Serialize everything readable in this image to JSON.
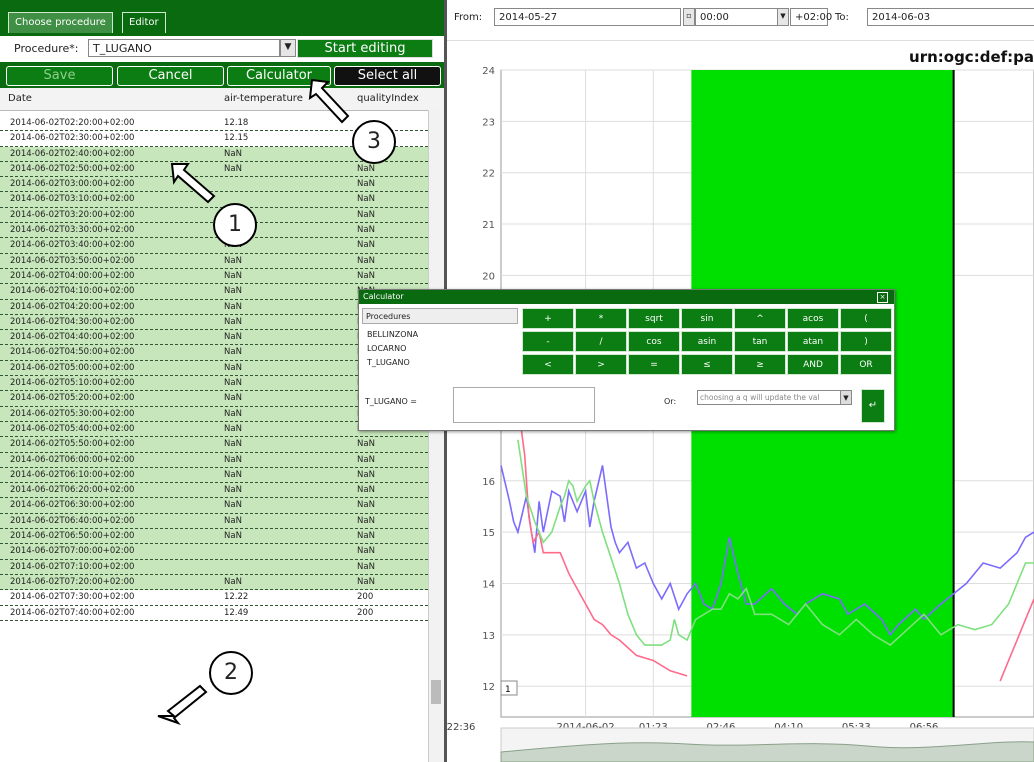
{
  "tabs": [
    {
      "label": "Choose procedure"
    },
    {
      "label": "Editor"
    }
  ],
  "procedure": {
    "label": "Procedure*:",
    "value": "T_LUGANO",
    "start_label": "Start editing"
  },
  "toolbar": {
    "save": "Save",
    "cancel": "Cancel",
    "calculator": "Calculator",
    "select_all": "Select all"
  },
  "table": {
    "headers": [
      "Date",
      "air-temperature",
      "qualityIndex"
    ],
    "rows": [
      {
        "date": "2014-06-02T02:20:00+02:00",
        "temp": "12.18",
        "q": ""
      },
      {
        "date": "2014-06-02T02:30:00+02:00",
        "temp": "12.15",
        "q": ""
      },
      {
        "date": "2014-06-02T02:40:00+02:00",
        "temp": "NaN",
        "q": "NaN"
      },
      {
        "date": "2014-06-02T02:50:00+02:00",
        "temp": "NaN",
        "q": "NaN"
      },
      {
        "date": "2014-06-02T03:00:00+02:00",
        "temp": "",
        "q": "NaN"
      },
      {
        "date": "2014-06-02T03:10:00+02:00",
        "temp": "",
        "q": "NaN"
      },
      {
        "date": "2014-06-02T03:20:00+02:00",
        "temp": "",
        "q": "NaN"
      },
      {
        "date": "2014-06-02T03:30:00+02:00",
        "temp": "NaN",
        "q": "NaN"
      },
      {
        "date": "2014-06-02T03:40:00+02:00",
        "temp": "NaN",
        "q": "NaN"
      },
      {
        "date": "2014-06-02T03:50:00+02:00",
        "temp": "NaN",
        "q": "NaN"
      },
      {
        "date": "2014-06-02T04:00:00+02:00",
        "temp": "NaN",
        "q": "NaN"
      },
      {
        "date": "2014-06-02T04:10:00+02:00",
        "temp": "NaN",
        "q": "NaN"
      },
      {
        "date": "2014-06-02T04:20:00+02:00",
        "temp": "NaN",
        "q": "NaN"
      },
      {
        "date": "2014-06-02T04:30:00+02:00",
        "temp": "NaN",
        "q": "NaN"
      },
      {
        "date": "2014-06-02T04:40:00+02:00",
        "temp": "NaN",
        "q": "NaN"
      },
      {
        "date": "2014-06-02T04:50:00+02:00",
        "temp": "NaN",
        "q": "NaN"
      },
      {
        "date": "2014-06-02T05:00:00+02:00",
        "temp": "NaN",
        "q": "NaN"
      },
      {
        "date": "2014-06-02T05:10:00+02:00",
        "temp": "NaN",
        "q": "NaN"
      },
      {
        "date": "2014-06-02T05:20:00+02:00",
        "temp": "NaN",
        "q": "NaN"
      },
      {
        "date": "2014-06-02T05:30:00+02:00",
        "temp": "NaN",
        "q": "NaN"
      },
      {
        "date": "2014-06-02T05:40:00+02:00",
        "temp": "NaN",
        "q": "NaN"
      },
      {
        "date": "2014-06-02T05:50:00+02:00",
        "temp": "NaN",
        "q": "NaN"
      },
      {
        "date": "2014-06-02T06:00:00+02:00",
        "temp": "NaN",
        "q": "NaN"
      },
      {
        "date": "2014-06-02T06:10:00+02:00",
        "temp": "NaN",
        "q": "NaN"
      },
      {
        "date": "2014-06-02T06:20:00+02:00",
        "temp": "NaN",
        "q": "NaN"
      },
      {
        "date": "2014-06-02T06:30:00+02:00",
        "temp": "NaN",
        "q": "NaN"
      },
      {
        "date": "2014-06-02T06:40:00+02:00",
        "temp": "NaN",
        "q": "NaN"
      },
      {
        "date": "2014-06-02T06:50:00+02:00",
        "temp": "NaN",
        "q": "NaN"
      },
      {
        "date": "2014-06-02T07:00:00+02:00",
        "temp": "",
        "q": "NaN"
      },
      {
        "date": "2014-06-02T07:10:00+02:00",
        "temp": "",
        "q": "NaN"
      },
      {
        "date": "2014-06-02T07:20:00+02:00",
        "temp": "NaN",
        "q": "NaN"
      },
      {
        "date": "2014-06-02T07:30:00+02:00",
        "temp": "12.22",
        "q": "200"
      },
      {
        "date": "2014-06-02T07:40:00+02:00",
        "temp": "12.49",
        "q": "200"
      }
    ],
    "selected_from": 2,
    "selected_to": 30
  },
  "filter": {
    "from_label": "From:",
    "from_date": "2014-05-27",
    "from_time": "00:00",
    "offset": "+02:00",
    "to_label": "To:",
    "to_date": "2014-06-03"
  },
  "chart_data": {
    "type": "line",
    "title": "urn:ogc:def:pa",
    "ylim": [
      11.4,
      24
    ],
    "yticks": [
      12,
      13,
      14,
      15,
      16,
      20,
      21,
      22,
      23,
      24
    ],
    "xlabels": [
      "22:36",
      "2014-06-02",
      "01:23",
      "02:46",
      "04:10",
      "05:33",
      "06:56"
    ],
    "highlight_range": [
      "02:46",
      "07:20"
    ],
    "grid": true,
    "series": [
      {
        "color": "#7b6bff",
        "values": [
          [
            0.0,
            16.3
          ],
          [
            0.1,
            15.6
          ],
          [
            0.15,
            15.2
          ],
          [
            0.2,
            15.0
          ],
          [
            0.3,
            15.7
          ],
          [
            0.35,
            15.1
          ],
          [
            0.4,
            14.6
          ],
          [
            0.45,
            15.6
          ],
          [
            0.5,
            15.0
          ],
          [
            0.6,
            15.8
          ],
          [
            0.7,
            15.7
          ],
          [
            0.75,
            15.2
          ],
          [
            0.8,
            15.8
          ],
          [
            0.9,
            15.4
          ],
          [
            1.0,
            15.8
          ],
          [
            1.05,
            15.1
          ],
          [
            1.1,
            15.6
          ],
          [
            1.2,
            16.3
          ],
          [
            1.3,
            15.1
          ],
          [
            1.35,
            14.8
          ],
          [
            1.4,
            14.6
          ],
          [
            1.5,
            14.8
          ],
          [
            1.6,
            14.3
          ],
          [
            1.7,
            14.4
          ],
          [
            1.8,
            14.0
          ],
          [
            1.9,
            13.7
          ],
          [
            2.0,
            14.0
          ],
          [
            2.1,
            13.5
          ],
          [
            2.2,
            13.8
          ],
          [
            2.3,
            14.0
          ],
          [
            2.4,
            13.6
          ],
          [
            2.5,
            13.5
          ],
          [
            2.6,
            14.0
          ],
          [
            2.7,
            14.9
          ],
          [
            2.8,
            14.2
          ],
          [
            2.9,
            13.6
          ],
          [
            3.0,
            13.6
          ],
          [
            3.2,
            13.9
          ],
          [
            3.35,
            13.6
          ],
          [
            3.5,
            13.4
          ],
          [
            3.6,
            13.6
          ],
          [
            3.8,
            13.8
          ],
          [
            4.0,
            13.7
          ],
          [
            4.1,
            13.4
          ],
          [
            4.3,
            13.6
          ],
          [
            4.5,
            13.3
          ],
          [
            4.6,
            13.0
          ],
          [
            4.7,
            13.2
          ],
          [
            4.9,
            13.5
          ],
          [
            5.0,
            13.3
          ],
          [
            5.2,
            13.6
          ],
          [
            5.5,
            14.0
          ],
          [
            5.7,
            14.4
          ],
          [
            5.9,
            14.3
          ],
          [
            6.1,
            14.6
          ],
          [
            6.2,
            14.9
          ],
          [
            6.3,
            15.0
          ]
        ]
      },
      {
        "color": "#ff6b8a",
        "values": [
          [
            0.2,
            17.5
          ],
          [
            0.28,
            16.5
          ],
          [
            0.33,
            15.3
          ],
          [
            0.38,
            14.8
          ],
          [
            0.45,
            15.0
          ],
          [
            0.5,
            14.6
          ],
          [
            0.6,
            14.6
          ],
          [
            0.7,
            14.6
          ],
          [
            0.8,
            14.2
          ],
          [
            0.9,
            13.9
          ],
          [
            1.0,
            13.6
          ],
          [
            1.1,
            13.3
          ],
          [
            1.2,
            13.2
          ],
          [
            1.3,
            13.0
          ],
          [
            1.4,
            12.9
          ],
          [
            1.6,
            12.6
          ],
          [
            1.8,
            12.5
          ],
          [
            2.0,
            12.3
          ],
          [
            2.2,
            12.2
          ]
        ]
      },
      {
        "color": "#7fe07f",
        "values": [
          [
            0.2,
            16.8
          ],
          [
            0.3,
            15.7
          ],
          [
            0.4,
            15.2
          ],
          [
            0.5,
            14.8
          ],
          [
            0.6,
            15.0
          ],
          [
            0.7,
            15.5
          ],
          [
            0.75,
            15.7
          ],
          [
            0.8,
            16.0
          ],
          [
            0.85,
            15.9
          ],
          [
            0.9,
            15.6
          ],
          [
            1.0,
            15.9
          ],
          [
            1.05,
            16.0
          ],
          [
            1.1,
            15.6
          ],
          [
            1.2,
            15.0
          ],
          [
            1.3,
            14.5
          ],
          [
            1.4,
            14.0
          ],
          [
            1.5,
            13.4
          ],
          [
            1.6,
            13.0
          ],
          [
            1.7,
            12.8
          ],
          [
            1.9,
            12.8
          ],
          [
            2.0,
            12.9
          ],
          [
            2.05,
            13.3
          ],
          [
            2.1,
            13.0
          ],
          [
            2.2,
            12.9
          ],
          [
            2.3,
            13.3
          ],
          [
            2.5,
            13.5
          ],
          [
            2.6,
            13.5
          ],
          [
            2.7,
            13.8
          ],
          [
            2.8,
            13.7
          ],
          [
            2.9,
            13.9
          ],
          [
            3.0,
            13.4
          ],
          [
            3.2,
            13.4
          ],
          [
            3.4,
            13.2
          ],
          [
            3.6,
            13.6
          ],
          [
            3.8,
            13.2
          ],
          [
            4.0,
            13.0
          ],
          [
            4.2,
            13.3
          ],
          [
            4.4,
            13.0
          ],
          [
            4.6,
            12.8
          ],
          [
            4.8,
            13.1
          ],
          [
            5.0,
            13.4
          ],
          [
            5.2,
            13.0
          ],
          [
            5.4,
            13.2
          ],
          [
            5.6,
            13.1
          ],
          [
            5.8,
            13.2
          ],
          [
            6.0,
            13.6
          ],
          [
            6.2,
            14.4
          ],
          [
            6.3,
            14.4
          ]
        ]
      },
      {
        "color": "#ff6b8a",
        "values": [
          [
            5.9,
            12.1
          ],
          [
            6.0,
            12.5
          ],
          [
            6.1,
            12.9
          ],
          [
            6.2,
            13.3
          ],
          [
            6.3,
            13.7
          ]
        ]
      }
    ],
    "x_domain": [
      0,
      6.3
    ]
  },
  "page_field": "1",
  "calculator": {
    "title": "Calculator",
    "procedures_header": "Procedures",
    "procedures": [
      "BELLINZONA",
      "LOCARNO",
      "T_LUGANO"
    ],
    "keys": [
      "+",
      "*",
      "sqrt",
      "sin",
      "^",
      "acos",
      "(",
      "-",
      "/",
      "cos",
      "asin",
      "tan",
      "atan",
      ")",
      "<",
      ">",
      "=",
      "≤",
      "≥",
      "AND",
      "OR"
    ],
    "target_label": "T_LUGANO =",
    "or_label": "Or:",
    "select_placeholder": "choosing a q will update the val",
    "go_label": "↵"
  },
  "callouts": [
    "1",
    "2",
    "3"
  ]
}
